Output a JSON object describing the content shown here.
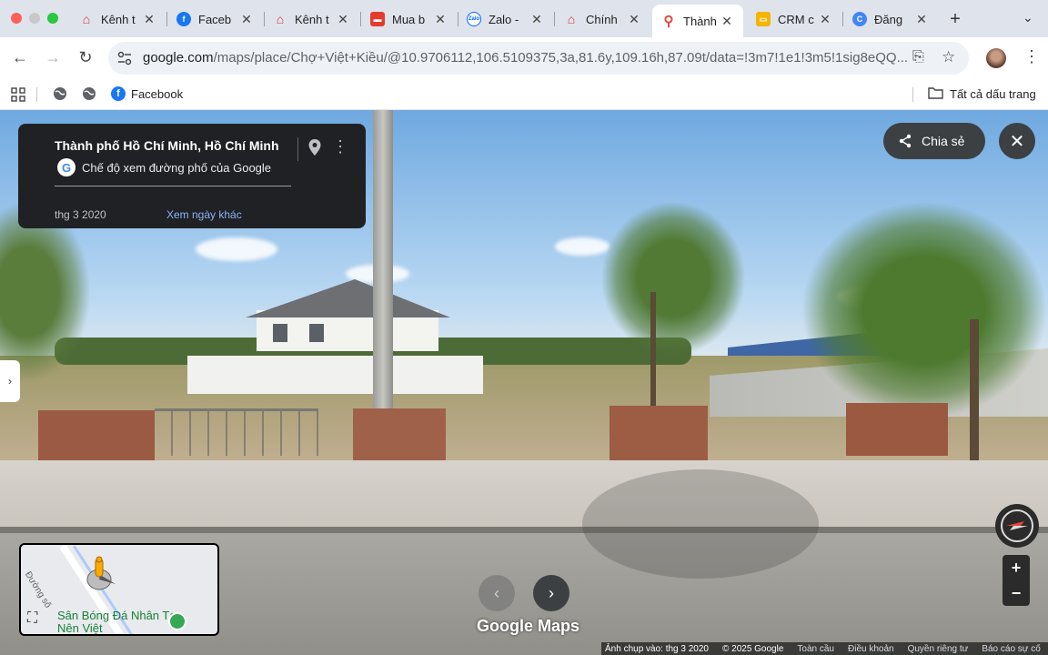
{
  "tabs": [
    {
      "title": "Kênh t",
      "icon": "red-chevron-icon",
      "color": "#e0313a"
    },
    {
      "title": "Faceb",
      "icon": "facebook-icon",
      "color": "#1877f2"
    },
    {
      "title": "Kênh t",
      "icon": "red-chevron-icon",
      "color": "#e0313a"
    },
    {
      "title": "Mua b",
      "icon": "chotot-icon",
      "color": "#e33b2e"
    },
    {
      "title": "Zalo -",
      "icon": "zalo-icon",
      "color": "#0068ff"
    },
    {
      "title": "Chính",
      "icon": "red-chevron-icon",
      "color": "#e0313a"
    },
    {
      "title": "Thành",
      "icon": "google-maps-pin-icon",
      "color": "#ea4335",
      "active": true
    },
    {
      "title": "CRM c",
      "icon": "crm-icon",
      "color": "#f4b400"
    },
    {
      "title": "Đăng",
      "icon": "chrome-c-icon",
      "color": "#4285f4"
    }
  ],
  "toolbar": {
    "url_domain": "google.com",
    "url_path": "/maps/place/Chợ+Việt+Kiều/@10.9706112,106.5109375,3a,81.6y,109.16h,87.09t/data=!3m7!1e1!3m5!1sig8eQQ..."
  },
  "bookmarks": {
    "facebook": "Facebook",
    "all_bookmarks": "Tất cả dấu trang"
  },
  "info_card": {
    "title": "Thành phố Hồ Chí Minh, Hồ Chí Minh",
    "subtitle": "Chế độ xem đường phố của Google",
    "date": "thg 3 2020",
    "other_dates": "Xem ngày khác"
  },
  "share_label": "Chia sẻ",
  "minimap": {
    "street": "Đường số",
    "place": "Sân Bóng Đá Nhân Tạo Nên Việt"
  },
  "logo_text": "Google Maps",
  "footer": {
    "captured": "Ảnh chụp vào: thg 3 2020",
    "copyright": "© 2025 Google",
    "whole": "Toàn cầu",
    "terms": "Điều khoản",
    "privacy": "Quyền riêng tư",
    "report": "Báo cáo sự cố"
  },
  "colors": {
    "tab_strip": "#dfe3eb",
    "card_bg": "#202124",
    "link": "#8ab4f8"
  }
}
